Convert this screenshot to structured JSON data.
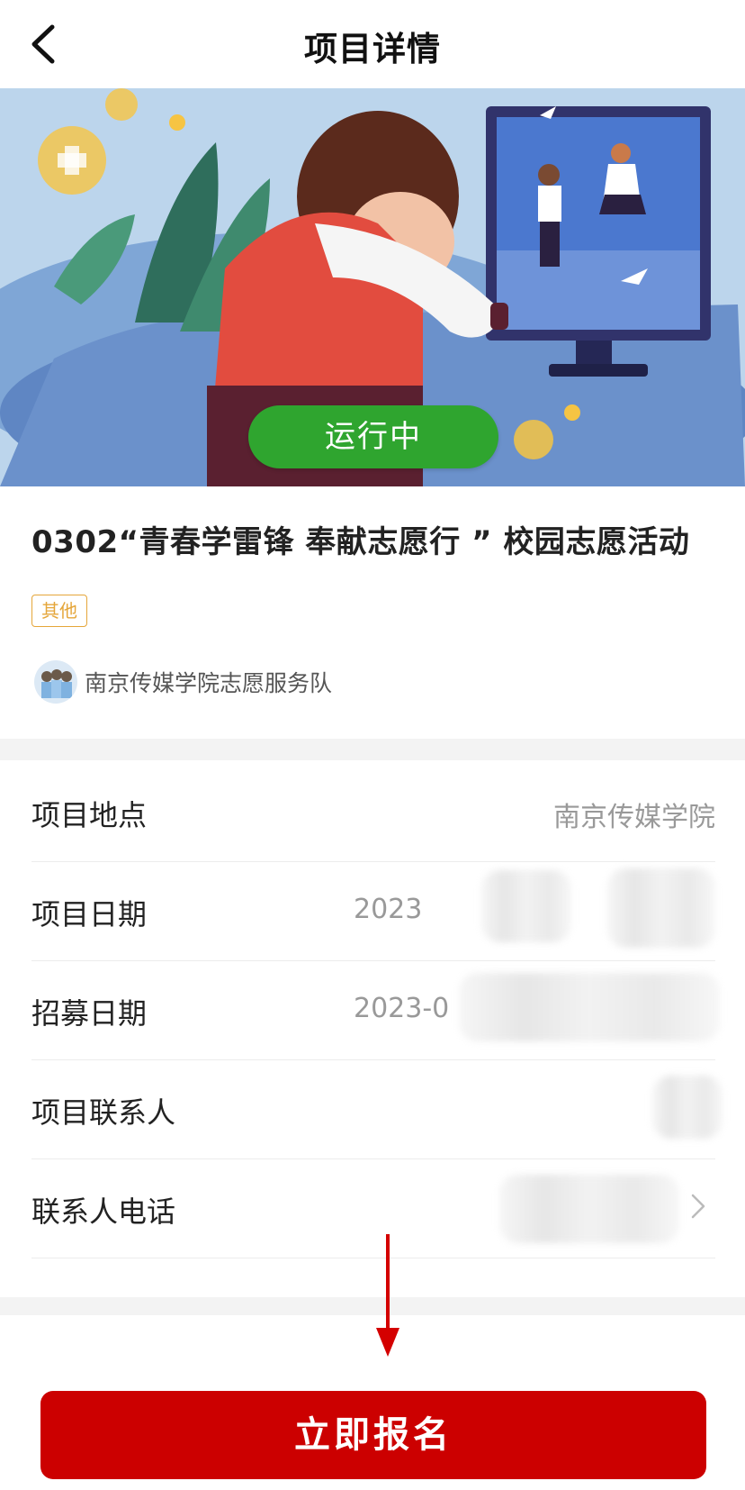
{
  "nav": {
    "title": "项目详情",
    "back_icon": "chevron-left-icon"
  },
  "banner": {
    "status": "运行中",
    "status_color": "#2fa52f"
  },
  "project": {
    "title": "0302“青春学雷锋 奉献志愿行 ” 校园志愿活动",
    "tag": "其他",
    "tag_color": "#e5a63a",
    "org_name": "南京传媒学院志愿服务队"
  },
  "details": [
    {
      "label": "项目地点",
      "value": "南京传媒学院"
    },
    {
      "label": "项目日期",
      "value": "2023"
    },
    {
      "label": "招募日期",
      "value": "2023-0"
    },
    {
      "label": "项目联系人",
      "value": ""
    },
    {
      "label": "联系人电话",
      "value": ""
    }
  ],
  "action": {
    "signup_label": "立即报名",
    "accent": "#cc0000"
  }
}
